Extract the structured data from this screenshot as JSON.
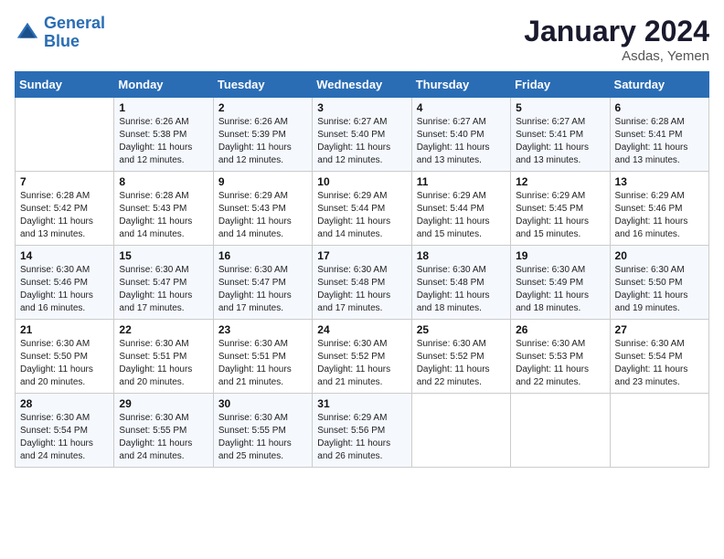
{
  "logo": {
    "line1": "General",
    "line2": "Blue"
  },
  "title": "January 2024",
  "location": "Asdas, Yemen",
  "days_header": [
    "Sunday",
    "Monday",
    "Tuesday",
    "Wednesday",
    "Thursday",
    "Friday",
    "Saturday"
  ],
  "weeks": [
    [
      {
        "num": "",
        "sunrise": "",
        "sunset": "",
        "daylight": ""
      },
      {
        "num": "1",
        "sunrise": "6:26 AM",
        "sunset": "5:38 PM",
        "daylight": "11 hours and 12 minutes."
      },
      {
        "num": "2",
        "sunrise": "6:26 AM",
        "sunset": "5:39 PM",
        "daylight": "11 hours and 12 minutes."
      },
      {
        "num": "3",
        "sunrise": "6:27 AM",
        "sunset": "5:40 PM",
        "daylight": "11 hours and 12 minutes."
      },
      {
        "num": "4",
        "sunrise": "6:27 AM",
        "sunset": "5:40 PM",
        "daylight": "11 hours and 13 minutes."
      },
      {
        "num": "5",
        "sunrise": "6:27 AM",
        "sunset": "5:41 PM",
        "daylight": "11 hours and 13 minutes."
      },
      {
        "num": "6",
        "sunrise": "6:28 AM",
        "sunset": "5:41 PM",
        "daylight": "11 hours and 13 minutes."
      }
    ],
    [
      {
        "num": "7",
        "sunrise": "6:28 AM",
        "sunset": "5:42 PM",
        "daylight": "11 hours and 13 minutes."
      },
      {
        "num": "8",
        "sunrise": "6:28 AM",
        "sunset": "5:43 PM",
        "daylight": "11 hours and 14 minutes."
      },
      {
        "num": "9",
        "sunrise": "6:29 AM",
        "sunset": "5:43 PM",
        "daylight": "11 hours and 14 minutes."
      },
      {
        "num": "10",
        "sunrise": "6:29 AM",
        "sunset": "5:44 PM",
        "daylight": "11 hours and 14 minutes."
      },
      {
        "num": "11",
        "sunrise": "6:29 AM",
        "sunset": "5:44 PM",
        "daylight": "11 hours and 15 minutes."
      },
      {
        "num": "12",
        "sunrise": "6:29 AM",
        "sunset": "5:45 PM",
        "daylight": "11 hours and 15 minutes."
      },
      {
        "num": "13",
        "sunrise": "6:29 AM",
        "sunset": "5:46 PM",
        "daylight": "11 hours and 16 minutes."
      }
    ],
    [
      {
        "num": "14",
        "sunrise": "6:30 AM",
        "sunset": "5:46 PM",
        "daylight": "11 hours and 16 minutes."
      },
      {
        "num": "15",
        "sunrise": "6:30 AM",
        "sunset": "5:47 PM",
        "daylight": "11 hours and 17 minutes."
      },
      {
        "num": "16",
        "sunrise": "6:30 AM",
        "sunset": "5:47 PM",
        "daylight": "11 hours and 17 minutes."
      },
      {
        "num": "17",
        "sunrise": "6:30 AM",
        "sunset": "5:48 PM",
        "daylight": "11 hours and 17 minutes."
      },
      {
        "num": "18",
        "sunrise": "6:30 AM",
        "sunset": "5:48 PM",
        "daylight": "11 hours and 18 minutes."
      },
      {
        "num": "19",
        "sunrise": "6:30 AM",
        "sunset": "5:49 PM",
        "daylight": "11 hours and 18 minutes."
      },
      {
        "num": "20",
        "sunrise": "6:30 AM",
        "sunset": "5:50 PM",
        "daylight": "11 hours and 19 minutes."
      }
    ],
    [
      {
        "num": "21",
        "sunrise": "6:30 AM",
        "sunset": "5:50 PM",
        "daylight": "11 hours and 20 minutes."
      },
      {
        "num": "22",
        "sunrise": "6:30 AM",
        "sunset": "5:51 PM",
        "daylight": "11 hours and 20 minutes."
      },
      {
        "num": "23",
        "sunrise": "6:30 AM",
        "sunset": "5:51 PM",
        "daylight": "11 hours and 21 minutes."
      },
      {
        "num": "24",
        "sunrise": "6:30 AM",
        "sunset": "5:52 PM",
        "daylight": "11 hours and 21 minutes."
      },
      {
        "num": "25",
        "sunrise": "6:30 AM",
        "sunset": "5:52 PM",
        "daylight": "11 hours and 22 minutes."
      },
      {
        "num": "26",
        "sunrise": "6:30 AM",
        "sunset": "5:53 PM",
        "daylight": "11 hours and 22 minutes."
      },
      {
        "num": "27",
        "sunrise": "6:30 AM",
        "sunset": "5:54 PM",
        "daylight": "11 hours and 23 minutes."
      }
    ],
    [
      {
        "num": "28",
        "sunrise": "6:30 AM",
        "sunset": "5:54 PM",
        "daylight": "11 hours and 24 minutes."
      },
      {
        "num": "29",
        "sunrise": "6:30 AM",
        "sunset": "5:55 PM",
        "daylight": "11 hours and 24 minutes."
      },
      {
        "num": "30",
        "sunrise": "6:30 AM",
        "sunset": "5:55 PM",
        "daylight": "11 hours and 25 minutes."
      },
      {
        "num": "31",
        "sunrise": "6:29 AM",
        "sunset": "5:56 PM",
        "daylight": "11 hours and 26 minutes."
      },
      {
        "num": "",
        "sunrise": "",
        "sunset": "",
        "daylight": ""
      },
      {
        "num": "",
        "sunrise": "",
        "sunset": "",
        "daylight": ""
      },
      {
        "num": "",
        "sunrise": "",
        "sunset": "",
        "daylight": ""
      }
    ]
  ]
}
